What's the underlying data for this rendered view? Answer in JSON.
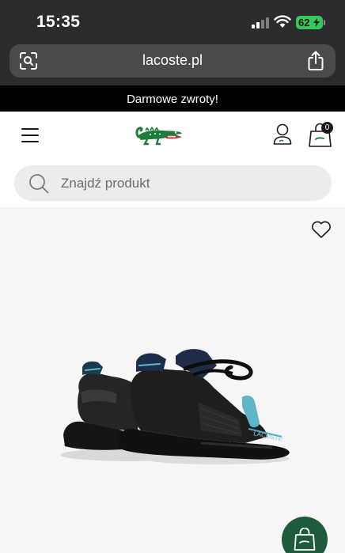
{
  "status_bar": {
    "time": "15:35",
    "battery": "62"
  },
  "browser": {
    "url": "lacoste.pl"
  },
  "promo": {
    "text": "Darmowe zwroty!"
  },
  "header": {
    "bag_count": "0"
  },
  "search": {
    "placeholder": "Znajdź produkt"
  },
  "colors": {
    "brand_green": "#1e5a3c",
    "promo_bg": "#000000",
    "chrome_bg": "#2c2c2e",
    "battery_green": "#34c759"
  },
  "icons": [
    "lens-icon",
    "share-icon",
    "menu-icon",
    "lacoste-crocodile-logo",
    "account-icon",
    "shopping-bag-icon",
    "search-icon",
    "heart-icon",
    "add-to-bag-icon"
  ]
}
